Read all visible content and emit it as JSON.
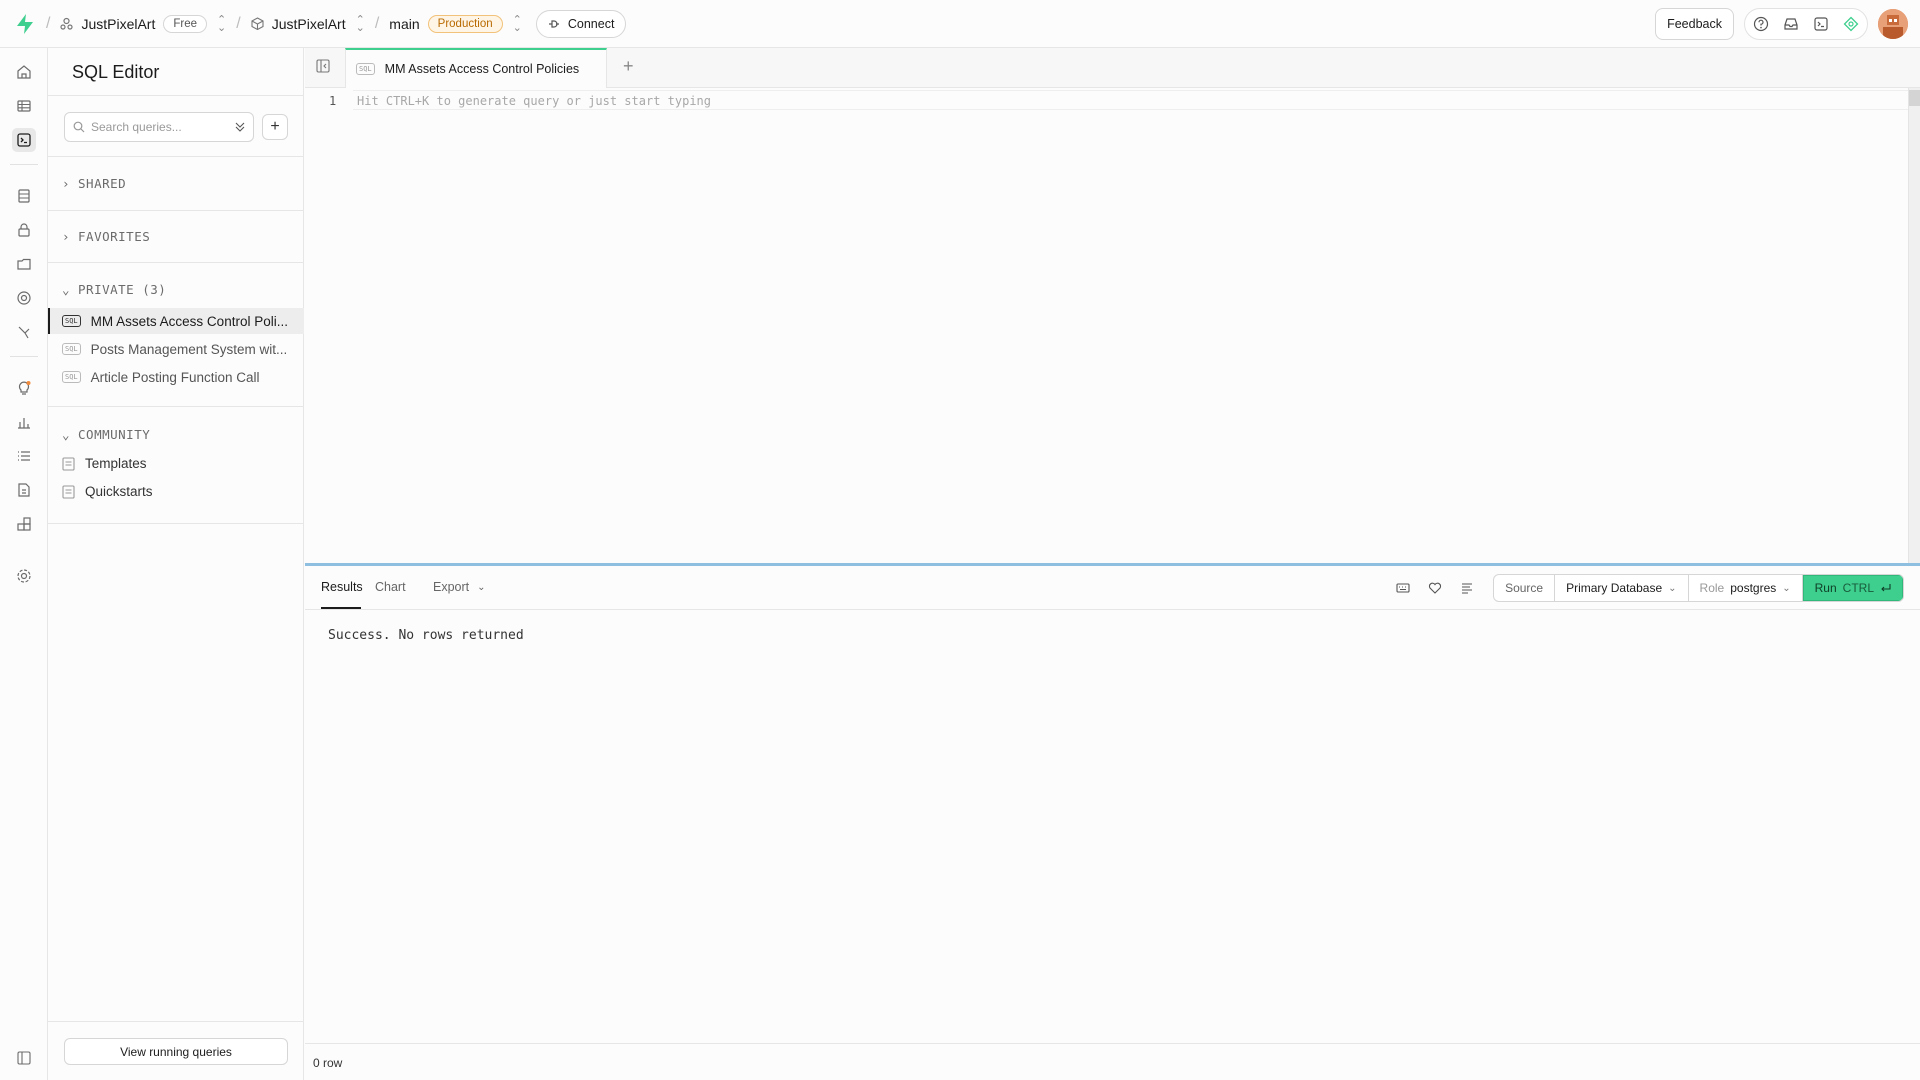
{
  "header": {
    "org_name": "JustPixelArt",
    "plan_badge": "Free",
    "project_name": "JustPixelArt",
    "branch_name": "main",
    "env_badge": "Production",
    "connect_label": "Connect",
    "feedback_label": "Feedback"
  },
  "sidebar": {
    "title": "SQL Editor",
    "search_placeholder": "Search queries...",
    "sections": {
      "shared": "SHARED",
      "favorites": "FAVORITES",
      "private": "PRIVATE (3)",
      "community": "COMMUNITY"
    },
    "private_queries": [
      {
        "label": "MM Assets Access Control Poli..."
      },
      {
        "label": "Posts Management System wit..."
      },
      {
        "label": "Article Posting Function Call"
      }
    ],
    "community_items": [
      {
        "label": "Templates"
      },
      {
        "label": "Quickstarts"
      }
    ],
    "sql_tag": "SQL",
    "view_running_label": "View running queries"
  },
  "editor": {
    "active_tab": "MM Assets Access Control Policies",
    "line_number": "1",
    "placeholder": "Hit CTRL+K to generate query or just start typing"
  },
  "results": {
    "tabs": {
      "results": "Results",
      "chart": "Chart",
      "export": "Export"
    },
    "source_label": "Source",
    "database": "Primary Database",
    "role_label": "Role",
    "role_value": "postgres",
    "run_label": "Run",
    "run_shortcut": "CTRL",
    "message": "Success. No rows returned",
    "row_count": "0 row"
  },
  "colors": {
    "accent": "#3ecf8e",
    "production": "#b86a00"
  }
}
